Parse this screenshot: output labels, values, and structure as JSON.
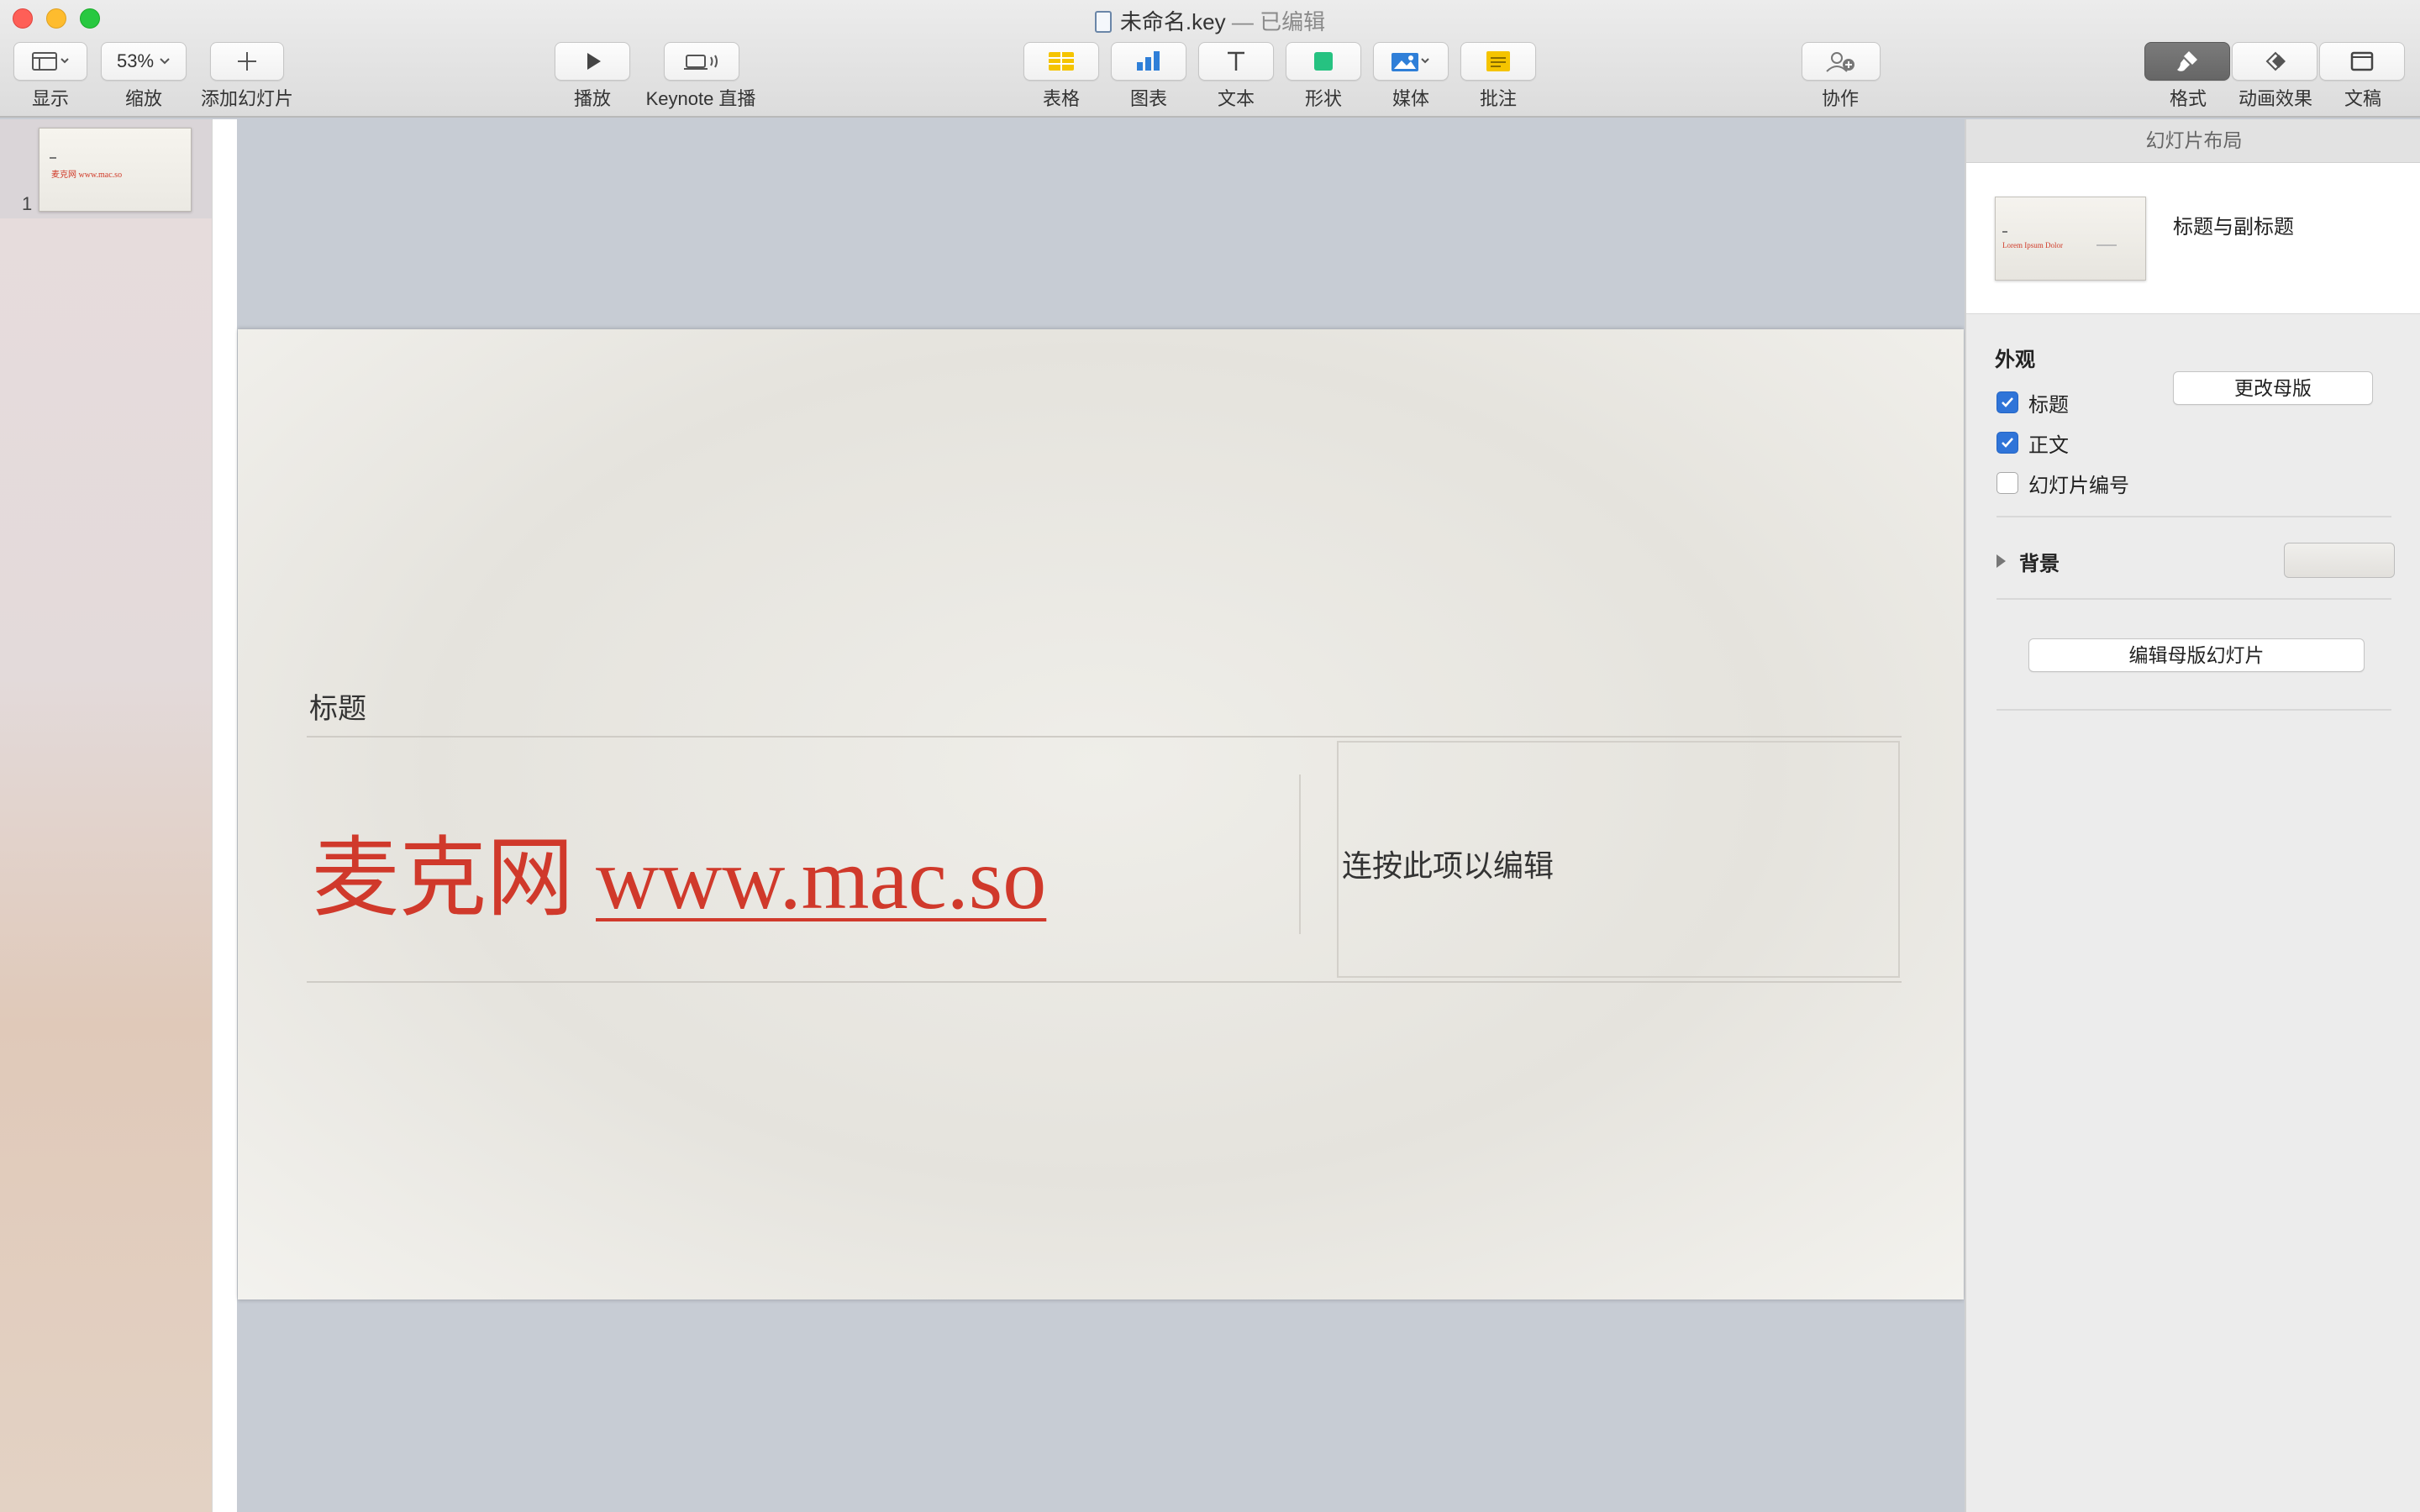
{
  "window": {
    "title": "未命名.key",
    "edited_suffix": "— 已编辑"
  },
  "toolbar": {
    "view_label": "显示",
    "zoom_value": "53%",
    "zoom_label": "缩放",
    "add_slide_label": "添加幻灯片",
    "play_label": "播放",
    "live_label": "Keynote 直播",
    "table_label": "表格",
    "chart_label": "图表",
    "text_label": "文本",
    "shape_label": "形状",
    "media_label": "媒体",
    "comment_label": "批注",
    "collaborate_label": "协作",
    "format_label": "格式",
    "animate_label": "动画效果",
    "document_label": "文稿"
  },
  "navigator": {
    "slide_number": "1"
  },
  "slide": {
    "title_placeholder": "标题",
    "subtitle_cn": "麦克网",
    "subtitle_url": "www.mac.so",
    "body_placeholder": "连按此项以编辑",
    "accent_color": "#d0392b"
  },
  "inspector": {
    "header": "幻灯片布局",
    "master_name": "标题与副标题",
    "change_master_button": "更改母版",
    "appearance_heading": "外观",
    "checkboxes": [
      {
        "label": "标题",
        "checked": true
      },
      {
        "label": "正文",
        "checked": true
      },
      {
        "label": "幻灯片编号",
        "checked": false
      }
    ],
    "background_label": "背景",
    "edit_master_button": "编辑母版幻灯片"
  },
  "icons": [
    "view-icon",
    "chevron-down-icon",
    "plus-icon",
    "play-icon",
    "keynote-live-icon",
    "table-icon",
    "chart-icon",
    "text-icon",
    "shape-icon",
    "media-icon",
    "comment-icon",
    "collaborate-icon",
    "format-brush-icon",
    "animate-icon",
    "document-icon"
  ]
}
